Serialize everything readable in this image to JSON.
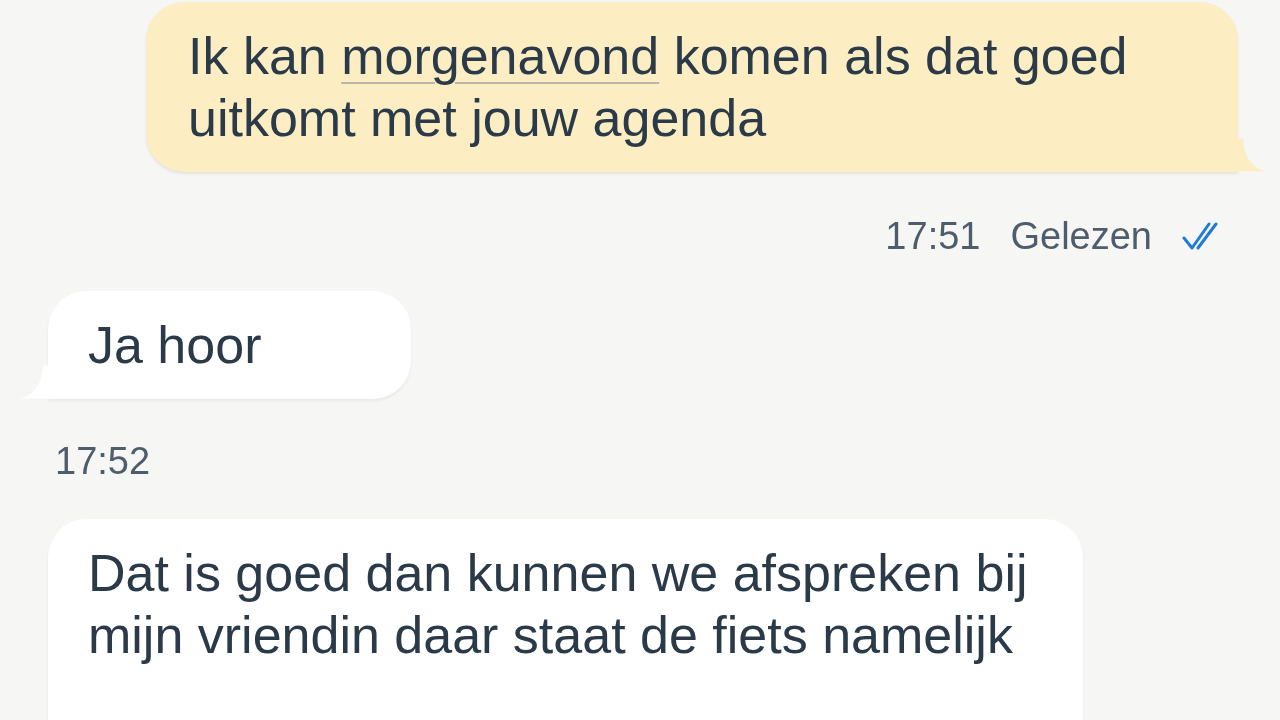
{
  "messages": [
    {
      "kind": "outgoing",
      "tail": true,
      "parts": [
        {
          "text": "Ik kan ",
          "underlined": false
        },
        {
          "text": "morgenavond",
          "underlined": true
        },
        {
          "text": " komen als dat goed uitkomt met jouw agenda",
          "underlined": false
        }
      ],
      "time": "17:51",
      "status": "Gelezen",
      "read": true
    },
    {
      "kind": "incoming",
      "tail": true,
      "parts": [
        {
          "text": "Ja hoor",
          "underlined": false
        }
      ],
      "time": "17:52"
    },
    {
      "kind": "incoming",
      "tail": false,
      "parts": [
        {
          "text": "Dat is goed dan kunnen we afspreken bij mijn vriendin daar staat de fiets namelijk",
          "underlined": false
        }
      ]
    }
  ]
}
